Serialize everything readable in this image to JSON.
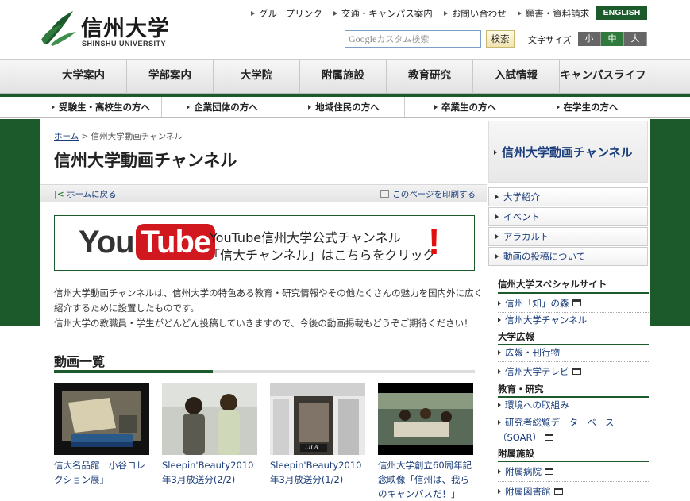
{
  "colors": {
    "brand_green": "#1d5a2b",
    "link_blue": "#1a3d7c",
    "youtube_red": "#d1181e"
  },
  "header": {
    "logo_name": "信州大学",
    "logo_en": "SHINSHU UNIVERSITY",
    "util_links": [
      "グループリンク",
      "交通・キャンパス案内",
      "お問い合わせ",
      "願書・資料請求"
    ],
    "english_label": "ENGLISH",
    "search_brand": "Google",
    "search_placeholder": "カスタム検索",
    "search_button": "検索",
    "fontsize_label": "文字サイズ",
    "fontsize_options": [
      "小",
      "中",
      "大"
    ]
  },
  "global_nav": [
    "大学案内",
    "学部案内",
    "大学院",
    "附属施設",
    "教育研究",
    "入試情報",
    "キャンパスライフ"
  ],
  "audience_nav": [
    "受験生・高校生の方へ",
    "企業団体の方へ",
    "地域住民の方へ",
    "卒業生の方へ",
    "在学生の方へ"
  ],
  "main": {
    "breadcrumb_home": "ホーム",
    "breadcrumb_sep": " > ",
    "breadcrumb_current": "信州大学動画チャンネル",
    "title": "信州大学動画チャンネル",
    "back_home": "ホームに戻る",
    "print": "このページを印刷する",
    "banner": {
      "you": "You",
      "tube": "Tube",
      "line1": "YouTube信州大学公式チャンネル",
      "line2": "「信大チャンネル」はこちらをクリック",
      "excl": "!"
    },
    "intro": [
      "信州大学動画チャンネルは、信州大学の特色ある教育・研究情報やその他たくさんの魅力を国内外に広く",
      "紹介するために設置したものです。",
      "信州大学の教職員・学生がどんどん投稿していきますので、今後の動画掲載もどうぞご期待ください！"
    ],
    "section_title": "動画一覧",
    "videos": [
      {
        "caption": "信大名品館「小谷コレクション展」"
      },
      {
        "caption": "Sleepin'Beauty2010年3月放送分(2/2)"
      },
      {
        "caption": "Sleepin'Beauty2010年3月放送分(1/2)",
        "shop_sign": "LILA"
      },
      {
        "caption": "信州大学創立60周年記念映像「信州は、我らのキャンパスだ！」"
      }
    ]
  },
  "sidebar": {
    "heading": "信州大学動画チャンネル",
    "items": [
      "大学紹介",
      "イベント",
      "アラカルト",
      "動画の投稿について"
    ],
    "groups": [
      {
        "title": "信州大学スペシャルサイト",
        "links": [
          {
            "label": "信州「知」の森",
            "ext": true
          },
          {
            "label": "信州大学チャンネル",
            "ext": false
          }
        ]
      },
      {
        "title": "大学広報",
        "links": [
          {
            "label": "広報・刊行物",
            "ext": false
          },
          {
            "label": "信州大学テレビ",
            "ext": true
          }
        ]
      },
      {
        "title": "教育・研究",
        "links": [
          {
            "label": "環境への取組み",
            "ext": false
          },
          {
            "label": "研究者総覧データーベース（SOAR）",
            "ext": true
          }
        ]
      },
      {
        "title": "附属施設",
        "links": [
          {
            "label": "附属病院",
            "ext": true
          },
          {
            "label": "附属図書館",
            "ext": true
          }
        ]
      }
    ]
  }
}
